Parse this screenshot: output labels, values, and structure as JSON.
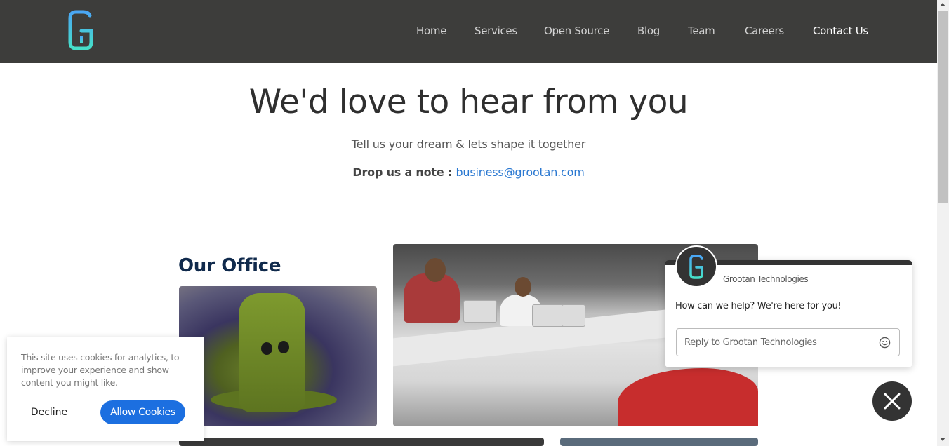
{
  "colors": {
    "header_bg": "#3d3d3b",
    "accent_link": "#2a78d1",
    "logo_gradient_start": "#3ad0f0",
    "logo_gradient_end": "#46e0c8",
    "cookie_button": "#1c6fe0",
    "chat_dark": "#333333"
  },
  "header": {
    "logo_icon": "grootan-g-logo",
    "nav": [
      {
        "label": "Home"
      },
      {
        "label": "Services"
      },
      {
        "label": "Open Source"
      },
      {
        "label": "Blog"
      },
      {
        "label": "Team"
      },
      {
        "label": "Careers"
      },
      {
        "label": "Contact Us",
        "active": true
      }
    ]
  },
  "hero": {
    "title": "We'd love to hear from you",
    "subtitle": "Tell us your dream & lets shape it together",
    "note_label": "Drop us a note : ",
    "email": "business@grootan.com"
  },
  "office": {
    "title": "Our Office"
  },
  "chat": {
    "company": "Grootan Technologies",
    "message": "How can we help? We're here for you!",
    "input_placeholder": "Reply to Grootan Technologies",
    "emoji_icon": "smiley-icon",
    "close_icon": "close-icon"
  },
  "cookie": {
    "text": "This site uses cookies for analytics, to improve your experience and show content you might like.",
    "decline_label": "Decline",
    "allow_label": "Allow Cookies"
  }
}
